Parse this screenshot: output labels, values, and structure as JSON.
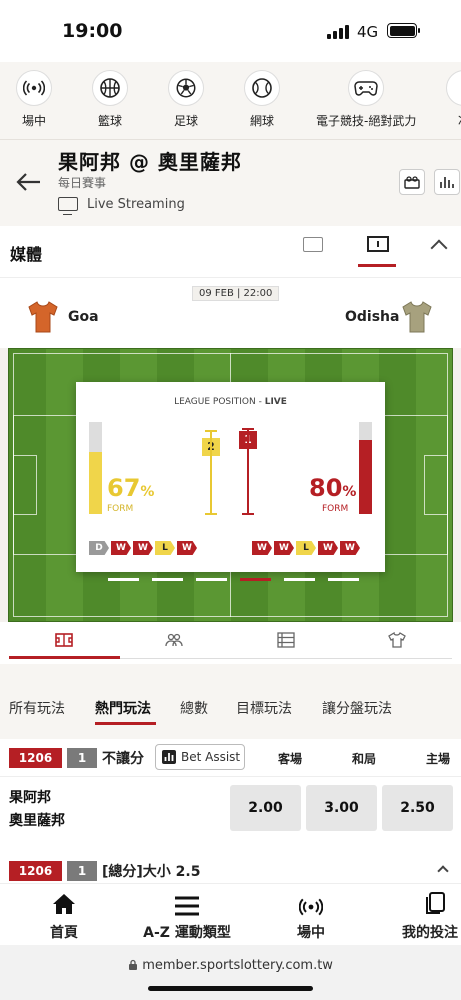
{
  "status": {
    "time": "19:00",
    "network": "4G"
  },
  "sports": [
    {
      "label": "場中",
      "icon": "live-signal-icon"
    },
    {
      "label": "籃球",
      "icon": "basketball-icon"
    },
    {
      "label": "足球",
      "icon": "soccer-ball-icon"
    },
    {
      "label": "網球",
      "icon": "tennis-ball-icon"
    },
    {
      "label": "電子競技-絕對武力",
      "icon": "gamepad-icon"
    },
    {
      "label": "冰",
      "icon": "hockey-icon"
    }
  ],
  "header": {
    "title": "果阿邦 @ 奧里薩邦",
    "subtitle": "每日賽事",
    "live_label": "Live Streaming"
  },
  "media": {
    "label": "媒體"
  },
  "match": {
    "date": "09 FEB | 22:00",
    "home": "Goa",
    "away": "Odisha"
  },
  "league": {
    "heading_prefix": "LEAGUE POSITION - ",
    "heading_live": "LIVE",
    "home": {
      "form_pct": "67",
      "form_fraction": 0.67,
      "position": "2",
      "results": [
        "D",
        "W",
        "W",
        "L",
        "W"
      ],
      "color": "#f0d54a"
    },
    "away": {
      "form_pct": "80",
      "form_fraction": 0.8,
      "position": "1",
      "results": [
        "W",
        "W",
        "L",
        "W",
        "W"
      ],
      "color": "#b51f24"
    },
    "pct_symbol": "%",
    "form_label": "FORM",
    "carousel_active": 3
  },
  "bet_tabs": [
    "所有玩法",
    "熱門玩法",
    "總數",
    "目標玩法",
    "讓分盤玩法"
  ],
  "active_bet_tab": 1,
  "market1": {
    "id": "1206",
    "num": "1",
    "name": "不讓分",
    "assist": "Bet Assist",
    "cols": [
      "客場",
      "和局",
      "主場"
    ],
    "teams": [
      "果阿邦",
      "奧里薩邦"
    ],
    "odds": [
      "2.00",
      "3.00",
      "2.50"
    ]
  },
  "market2": {
    "id": "1206",
    "num": "1",
    "name": "[總分]大小 2.5"
  },
  "bottom_nav": [
    {
      "label": "首頁",
      "icon": "home-icon"
    },
    {
      "label": "A-Z 運動類型",
      "icon": "menu-icon"
    },
    {
      "label": "場中",
      "icon": "live-signal-icon"
    },
    {
      "label": "我的投注",
      "icon": "bet-slip-icon"
    }
  ],
  "url": "member.sportslottery.com.tw",
  "colors": {
    "accent": "#b51f24",
    "pitch": "#5b9733",
    "yellow": "#f0d54a"
  }
}
